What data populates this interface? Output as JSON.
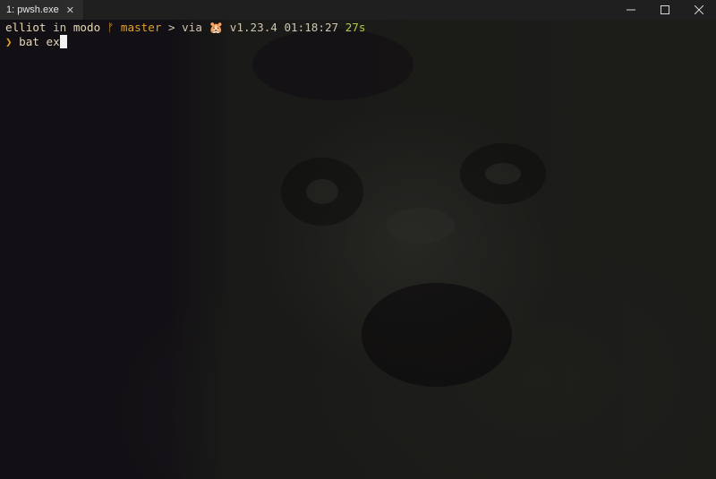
{
  "window": {
    "tab_title": "1: pwsh.exe",
    "tab_close_icon": "close-icon",
    "controls": [
      "minimize-icon",
      "maximize-icon",
      "close-icon"
    ]
  },
  "prompt": {
    "user": "elliot",
    "in_word": " in ",
    "directory": "modo",
    "branch_symbol": " ᚠ ",
    "branch": "master",
    "status": " > ",
    "via_word": "via ",
    "toolchain_icon": "🐹",
    "version": " v1.23.4",
    "time": " 01:18:27",
    "duration": " 27s"
  },
  "input": {
    "prompt_char": "❯",
    "command": " bat ex"
  },
  "colors": {
    "background": "#141115",
    "branch": "#dda12c",
    "duration": "#b7c64a",
    "text": "#e6d8b6"
  }
}
